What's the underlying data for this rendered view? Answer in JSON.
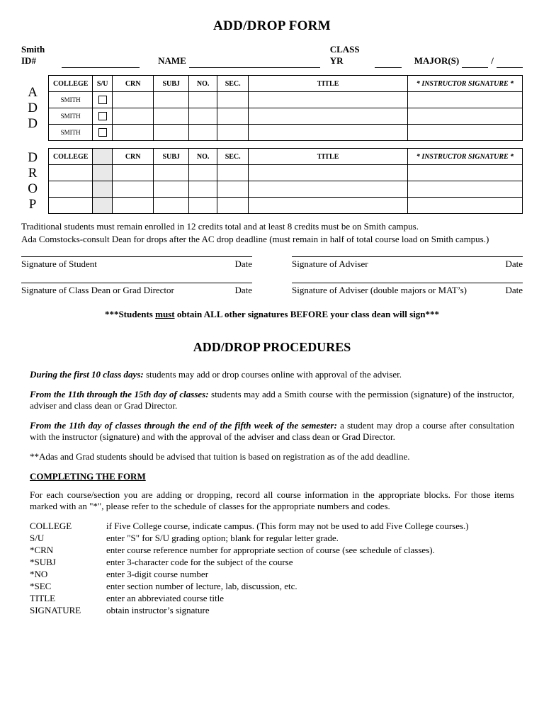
{
  "title": "ADD/DROP FORM",
  "idrow": {
    "smith_id_label": "Smith ID#",
    "name_label": "NAME",
    "classyr_label": "CLASS YR",
    "majors_label": "MAJOR(S)"
  },
  "cols": {
    "college": "COLLEGE",
    "su": "S/U",
    "crn": "CRN",
    "subj": "SUBJ",
    "no": "NO.",
    "sec": "SEC.",
    "title": "TITLE",
    "sig": "*  INSTRUCTOR SIGNATURE  *"
  },
  "add": {
    "vlabel": [
      "A",
      "D",
      "D"
    ],
    "rows_college": [
      "SMITH",
      "SMITH",
      "SMITH"
    ]
  },
  "drop": {
    "vlabel": [
      "D",
      "R",
      "O",
      "P"
    ]
  },
  "notes": {
    "line1": "Traditional students must remain enrolled in 12 credits total and at least 8 credits must be on Smith campus.",
    "line2": "Ada Comstocks-consult Dean for drops after the AC drop deadline (must remain in half of total course load on Smith campus.)"
  },
  "sigs": {
    "student": "Signature of Student",
    "adviser": "Signature of Adviser",
    "dean": "Signature of Class Dean or Grad Director",
    "adviser2": "Signature of Adviser (double majors or MAT’s)",
    "date": "Date"
  },
  "mustline": {
    "pre": "***Students ",
    "must": "must",
    "post": " obtain ALL other signatures BEFORE your class dean will sign***"
  },
  "proc_title": "ADD/DROP PROCEDURES",
  "procs": {
    "p1_lead": "During the first 10 class days:",
    "p1_rest": " students may add or drop courses online with approval of the adviser.",
    "p2_lead": "From the 11th through the 15th day of classes:",
    "p2_rest": " students may add a Smith course with the permission (signature) of the instructor, adviser and class dean or Grad Director.",
    "p3_lead": "From the 11th day of classes through the end of the fifth week of the semester:",
    "p3_rest": " a student may drop a course after consultation with the instructor (signature) and with the approval of the adviser and class dean or Grad Director.",
    "p4": "**Adas and Grad students should be advised that tuition is based on registration as of the add deadline."
  },
  "completing_header": "COMPLETING THE FORM",
  "completing_intro": "For each course/section you are adding or dropping, record all course information in the appropriate blocks.  For those items marked with an \"*\", please refer to the schedule of classes for the appropriate numbers and codes.",
  "defs": [
    {
      "k": " COLLEGE",
      "v_pre": "if Five College course, indicate campus.  (This form may ",
      "v_i1": "not",
      "v_mid": " be used to ",
      "v_i2": "add",
      "v_post": " Five College courses.)"
    },
    {
      "k": " S/U",
      "v": "enter \"S\" for S/U grading option; blank for regular letter grade."
    },
    {
      "k": "*CRN",
      "v": "enter course reference number for appropriate section of course (see schedule of classes)."
    },
    {
      "k": "*SUBJ",
      "v": "enter 3-character code for the subject of the course"
    },
    {
      "k": "*NO",
      "v": "enter 3-digit course number"
    },
    {
      "k": "*SEC",
      "v": "enter section number of lecture, lab, discussion, etc."
    },
    {
      "k": " TITLE",
      "v": "enter an abbreviated course title"
    },
    {
      "k": " SIGNATURE",
      "v": "obtain instructor’s signature"
    }
  ]
}
